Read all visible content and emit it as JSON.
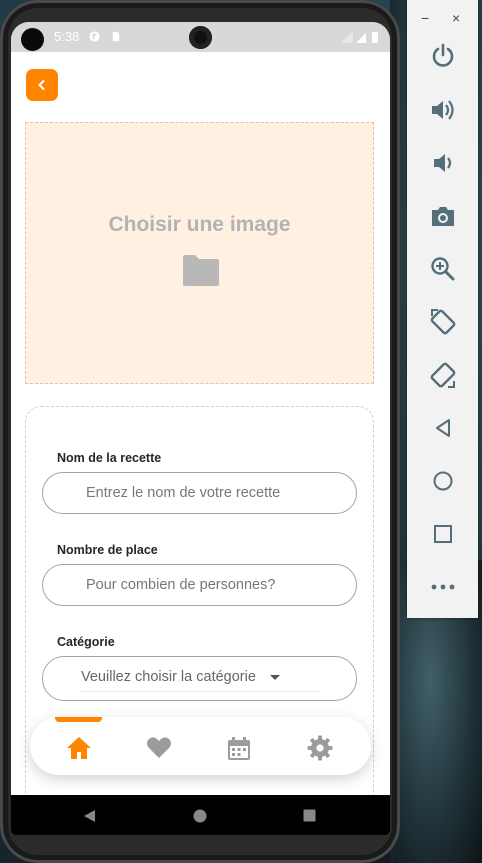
{
  "status": {
    "time": "5:38"
  },
  "image_picker": {
    "label": "Choisir une image"
  },
  "form": {
    "name": {
      "label": "Nom de la recette",
      "placeholder": "Entrez le nom de votre recette"
    },
    "places": {
      "label": "Nombre de place",
      "placeholder": "Pour combien de personnes?"
    },
    "category": {
      "label": "Catégorie",
      "value": "Veuillez choisir la catégorie"
    }
  },
  "bottom_nav": {
    "items": [
      {
        "icon": "home-icon",
        "active": true
      },
      {
        "icon": "heart-icon",
        "active": false
      },
      {
        "icon": "calendar-icon",
        "active": false
      },
      {
        "icon": "gear-icon",
        "active": false
      }
    ]
  },
  "emulator_panel": {
    "window_controls": [
      "−",
      "×"
    ],
    "buttons": [
      "power-icon",
      "volume-up-icon",
      "volume-down-icon",
      "camera-icon",
      "zoom-in-icon",
      "rotate-left-icon",
      "rotate-right-icon",
      "back-icon",
      "home-circle-icon",
      "overview-square-icon",
      "more-icon"
    ]
  },
  "colors": {
    "accent": "#ff8400",
    "image_bg": "#fff0e1",
    "inactive_icon": "#9b9b9b",
    "panel_icon": "#546e7a"
  }
}
